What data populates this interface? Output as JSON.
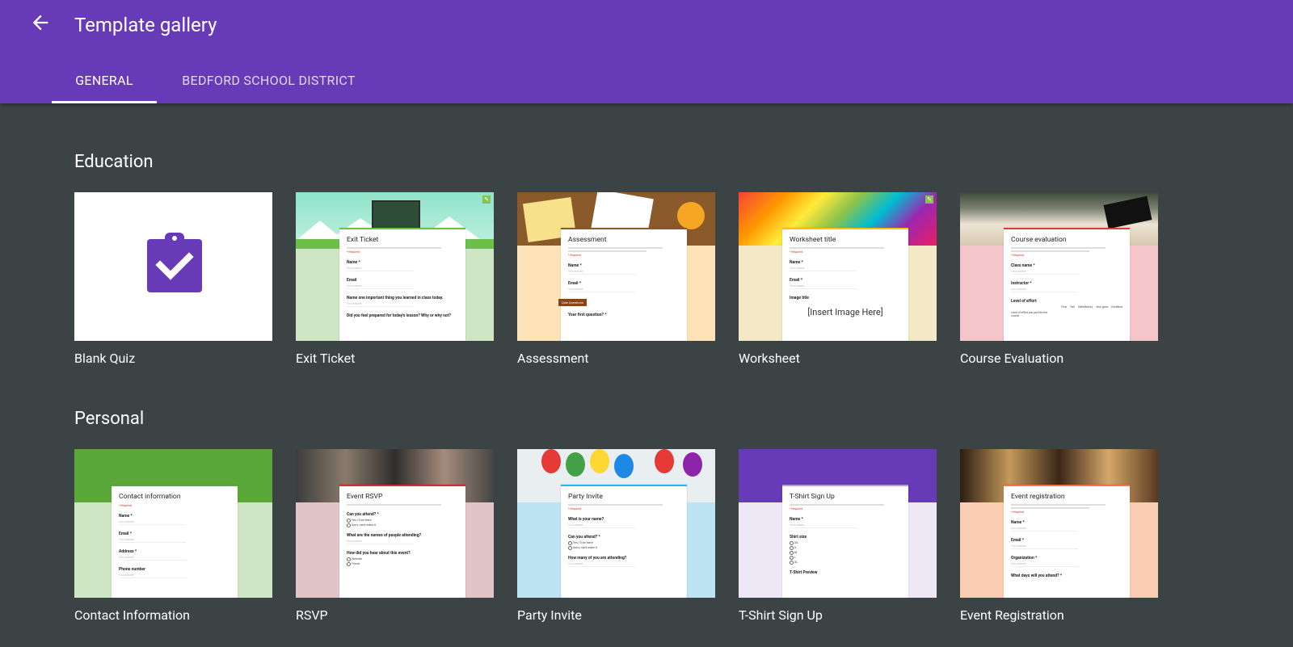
{
  "app": {
    "title": "Template gallery"
  },
  "tabs": [
    {
      "label": "GENERAL"
    },
    {
      "label": "BEDFORD SCHOOL DISTRICT"
    }
  ],
  "sections": [
    {
      "title": "Education",
      "cards": [
        {
          "label": "Blank Quiz"
        },
        {
          "label": "Exit Ticket",
          "form_title": "Exit Ticket",
          "fields": [
            "Name *",
            "Email",
            "Name one important thing you learned in class today.",
            "Did you feel prepared for today's lesson? Why or why not?"
          ]
        },
        {
          "label": "Assessment",
          "form_title": "Assessment",
          "fields": [
            "Name *",
            "Email *",
            "Your first question? *"
          ],
          "tag": "Quiz Questions"
        },
        {
          "label": "Worksheet",
          "form_title": "Worksheet title",
          "fields": [
            "Name *",
            "Email *",
            "Image title"
          ],
          "placeholder": "[Insert Image Here]"
        },
        {
          "label": "Course Evaluation",
          "form_title": "Course evaluation",
          "fields": [
            "Class name *",
            "Instructor *",
            "Level of effort",
            "Level of effort you put into the course"
          ],
          "scale": [
            "Poor",
            "Fair",
            "Satisfactory",
            "Very good",
            "Excellent"
          ]
        }
      ]
    },
    {
      "title": "Personal",
      "cards": [
        {
          "label": "Contact Information",
          "form_title": "Contact information",
          "fields": [
            "Name *",
            "Email *",
            "Address *",
            "Phone number"
          ]
        },
        {
          "label": "RSVP",
          "form_title": "Event RSVP",
          "fields": [
            "Can you attend? *",
            "What are the names of people attending?",
            "How did you hear about this event?"
          ],
          "options": [
            "Yes, I'll be there",
            "Sorry, can't make it",
            "Website",
            "Friend"
          ]
        },
        {
          "label": "Party Invite",
          "form_title": "Party Invite",
          "fields": [
            "What is your name?",
            "Can you attend? *",
            "How many of you are attending?"
          ],
          "options": [
            "Yes, I'll be there",
            "Sorry, can't make it"
          ]
        },
        {
          "label": "T-Shirt Sign Up",
          "form_title": "T-Shirt Sign Up",
          "fields": [
            "Name *",
            "Shirt size",
            "T-Shirt Preview"
          ],
          "options": [
            "XS",
            "S",
            "M",
            "L",
            "XL"
          ]
        },
        {
          "label": "Event Registration",
          "form_title": "Event registration",
          "fields": [
            "Name *",
            "Email *",
            "Organization *",
            "What days will you attend? *"
          ]
        }
      ]
    }
  ]
}
